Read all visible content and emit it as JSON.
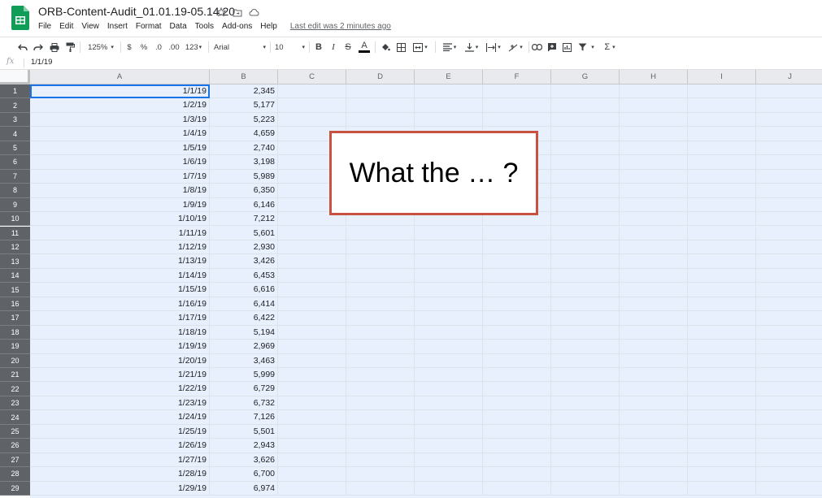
{
  "document": {
    "title": "ORB-Content-Audit_01.01.19-05.14.20",
    "last_edit": "Last edit was 2 minutes ago"
  },
  "menu": [
    "File",
    "Edit",
    "View",
    "Insert",
    "Format",
    "Data",
    "Tools",
    "Add-ons",
    "Help"
  ],
  "toolbar": {
    "zoom": "125%",
    "currency": "$",
    "percent": "%",
    "decrease_decimal": ".0",
    "increase_decimal": ".00",
    "more_formats": "123",
    "font": "Arial",
    "font_size": "10",
    "bold": "B",
    "italic": "I",
    "text_color": "A",
    "functions": "Σ"
  },
  "formula_bar": {
    "fx": "fx",
    "value": "1/1/19"
  },
  "columns": [
    "A",
    "B",
    "C",
    "D",
    "E",
    "F",
    "G",
    "H",
    "I",
    "J"
  ],
  "rows": [
    {
      "num": "1",
      "a": "1/1/19",
      "b": "2,345"
    },
    {
      "num": "2",
      "a": "1/2/19",
      "b": "5,177"
    },
    {
      "num": "3",
      "a": "1/3/19",
      "b": "5,223"
    },
    {
      "num": "4",
      "a": "1/4/19",
      "b": "4,659"
    },
    {
      "num": "5",
      "a": "1/5/19",
      "b": "2,740"
    },
    {
      "num": "6",
      "a": "1/6/19",
      "b": "3,198"
    },
    {
      "num": "7",
      "a": "1/7/19",
      "b": "5,989"
    },
    {
      "num": "8",
      "a": "1/8/19",
      "b": "6,350"
    },
    {
      "num": "9",
      "a": "1/9/19",
      "b": "6,146"
    },
    {
      "num": "10",
      "a": "1/10/19",
      "b": "7,212"
    },
    {
      "num": "11",
      "a": "1/11/19",
      "b": "5,601"
    },
    {
      "num": "12",
      "a": "1/12/19",
      "b": "2,930"
    },
    {
      "num": "13",
      "a": "1/13/19",
      "b": "3,426"
    },
    {
      "num": "14",
      "a": "1/14/19",
      "b": "6,453"
    },
    {
      "num": "15",
      "a": "1/15/19",
      "b": "6,616"
    },
    {
      "num": "16",
      "a": "1/16/19",
      "b": "6,414"
    },
    {
      "num": "17",
      "a": "1/17/19",
      "b": "6,422"
    },
    {
      "num": "18",
      "a": "1/18/19",
      "b": "5,194"
    },
    {
      "num": "19",
      "a": "1/19/19",
      "b": "2,969"
    },
    {
      "num": "20",
      "a": "1/20/19",
      "b": "3,463"
    },
    {
      "num": "21",
      "a": "1/21/19",
      "b": "5,999"
    },
    {
      "num": "22",
      "a": "1/22/19",
      "b": "6,729"
    },
    {
      "num": "23",
      "a": "1/23/19",
      "b": "6,732"
    },
    {
      "num": "24",
      "a": "1/24/19",
      "b": "7,126"
    },
    {
      "num": "25",
      "a": "1/25/19",
      "b": "5,501"
    },
    {
      "num": "26",
      "a": "1/26/19",
      "b": "2,943"
    },
    {
      "num": "27",
      "a": "1/27/19",
      "b": "3,626"
    },
    {
      "num": "28",
      "a": "1/28/19",
      "b": "6,700"
    },
    {
      "num": "29",
      "a": "1/29/19",
      "b": "6,974"
    }
  ],
  "callout": {
    "text": "What the … ?"
  },
  "colors": {
    "selection": "#e8f0fe",
    "active_border": "#1a73e8",
    "callout_border": "#c9513f",
    "sheets_green": "#0f9d58"
  }
}
